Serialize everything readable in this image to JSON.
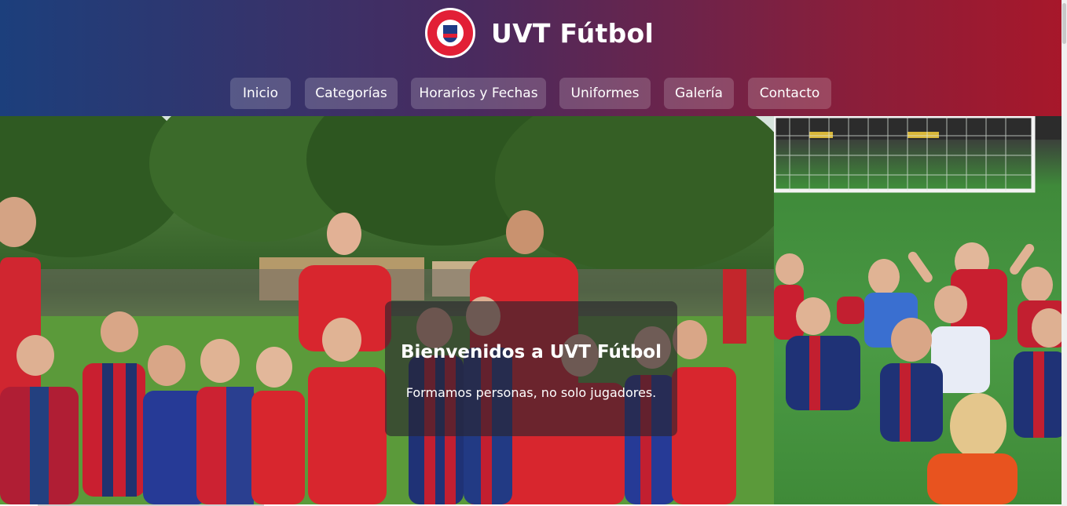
{
  "header": {
    "site_title": "UVT Fútbol",
    "logo_icon": "club-crest-logo",
    "gradient_colors": [
      "#1c3f7c",
      "#a8172a"
    ]
  },
  "nav": {
    "items": [
      {
        "label": "Inicio"
      },
      {
        "label": "Categorías"
      },
      {
        "label": "Horarios y Fechas"
      },
      {
        "label": "Uniformes"
      },
      {
        "label": "Galería"
      },
      {
        "label": "Contacto"
      }
    ]
  },
  "hero": {
    "title": "Bienvenidos a UVT Fútbol",
    "subtitle": "Formamos personas, no solo jugadores.",
    "images": [
      {
        "name": "team-photo-players-coaches"
      },
      {
        "name": "kids-celebrating-goalkeeper-gloves"
      }
    ]
  },
  "colors": {
    "kit_red": "#e21f36",
    "kit_blue": "#1f3b86",
    "grass": "#4a9a44"
  }
}
